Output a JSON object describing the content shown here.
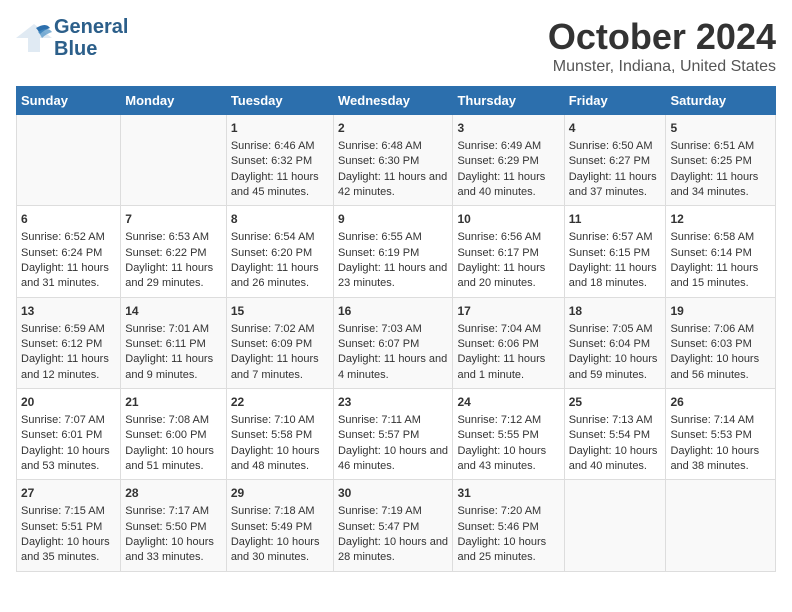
{
  "header": {
    "logo_general": "General",
    "logo_blue": "Blue",
    "title": "October 2024",
    "subtitle": "Munster, Indiana, United States"
  },
  "days_of_week": [
    "Sunday",
    "Monday",
    "Tuesday",
    "Wednesday",
    "Thursday",
    "Friday",
    "Saturday"
  ],
  "weeks": [
    [
      {
        "day": "",
        "content": ""
      },
      {
        "day": "",
        "content": ""
      },
      {
        "day": "1",
        "content": "Sunrise: 6:46 AM\nSunset: 6:32 PM\nDaylight: 11 hours and 45 minutes."
      },
      {
        "day": "2",
        "content": "Sunrise: 6:48 AM\nSunset: 6:30 PM\nDaylight: 11 hours and 42 minutes."
      },
      {
        "day": "3",
        "content": "Sunrise: 6:49 AM\nSunset: 6:29 PM\nDaylight: 11 hours and 40 minutes."
      },
      {
        "day": "4",
        "content": "Sunrise: 6:50 AM\nSunset: 6:27 PM\nDaylight: 11 hours and 37 minutes."
      },
      {
        "day": "5",
        "content": "Sunrise: 6:51 AM\nSunset: 6:25 PM\nDaylight: 11 hours and 34 minutes."
      }
    ],
    [
      {
        "day": "6",
        "content": "Sunrise: 6:52 AM\nSunset: 6:24 PM\nDaylight: 11 hours and 31 minutes."
      },
      {
        "day": "7",
        "content": "Sunrise: 6:53 AM\nSunset: 6:22 PM\nDaylight: 11 hours and 29 minutes."
      },
      {
        "day": "8",
        "content": "Sunrise: 6:54 AM\nSunset: 6:20 PM\nDaylight: 11 hours and 26 minutes."
      },
      {
        "day": "9",
        "content": "Sunrise: 6:55 AM\nSunset: 6:19 PM\nDaylight: 11 hours and 23 minutes."
      },
      {
        "day": "10",
        "content": "Sunrise: 6:56 AM\nSunset: 6:17 PM\nDaylight: 11 hours and 20 minutes."
      },
      {
        "day": "11",
        "content": "Sunrise: 6:57 AM\nSunset: 6:15 PM\nDaylight: 11 hours and 18 minutes."
      },
      {
        "day": "12",
        "content": "Sunrise: 6:58 AM\nSunset: 6:14 PM\nDaylight: 11 hours and 15 minutes."
      }
    ],
    [
      {
        "day": "13",
        "content": "Sunrise: 6:59 AM\nSunset: 6:12 PM\nDaylight: 11 hours and 12 minutes."
      },
      {
        "day": "14",
        "content": "Sunrise: 7:01 AM\nSunset: 6:11 PM\nDaylight: 11 hours and 9 minutes."
      },
      {
        "day": "15",
        "content": "Sunrise: 7:02 AM\nSunset: 6:09 PM\nDaylight: 11 hours and 7 minutes."
      },
      {
        "day": "16",
        "content": "Sunrise: 7:03 AM\nSunset: 6:07 PM\nDaylight: 11 hours and 4 minutes."
      },
      {
        "day": "17",
        "content": "Sunrise: 7:04 AM\nSunset: 6:06 PM\nDaylight: 11 hours and 1 minute."
      },
      {
        "day": "18",
        "content": "Sunrise: 7:05 AM\nSunset: 6:04 PM\nDaylight: 10 hours and 59 minutes."
      },
      {
        "day": "19",
        "content": "Sunrise: 7:06 AM\nSunset: 6:03 PM\nDaylight: 10 hours and 56 minutes."
      }
    ],
    [
      {
        "day": "20",
        "content": "Sunrise: 7:07 AM\nSunset: 6:01 PM\nDaylight: 10 hours and 53 minutes."
      },
      {
        "day": "21",
        "content": "Sunrise: 7:08 AM\nSunset: 6:00 PM\nDaylight: 10 hours and 51 minutes."
      },
      {
        "day": "22",
        "content": "Sunrise: 7:10 AM\nSunset: 5:58 PM\nDaylight: 10 hours and 48 minutes."
      },
      {
        "day": "23",
        "content": "Sunrise: 7:11 AM\nSunset: 5:57 PM\nDaylight: 10 hours and 46 minutes."
      },
      {
        "day": "24",
        "content": "Sunrise: 7:12 AM\nSunset: 5:55 PM\nDaylight: 10 hours and 43 minutes."
      },
      {
        "day": "25",
        "content": "Sunrise: 7:13 AM\nSunset: 5:54 PM\nDaylight: 10 hours and 40 minutes."
      },
      {
        "day": "26",
        "content": "Sunrise: 7:14 AM\nSunset: 5:53 PM\nDaylight: 10 hours and 38 minutes."
      }
    ],
    [
      {
        "day": "27",
        "content": "Sunrise: 7:15 AM\nSunset: 5:51 PM\nDaylight: 10 hours and 35 minutes."
      },
      {
        "day": "28",
        "content": "Sunrise: 7:17 AM\nSunset: 5:50 PM\nDaylight: 10 hours and 33 minutes."
      },
      {
        "day": "29",
        "content": "Sunrise: 7:18 AM\nSunset: 5:49 PM\nDaylight: 10 hours and 30 minutes."
      },
      {
        "day": "30",
        "content": "Sunrise: 7:19 AM\nSunset: 5:47 PM\nDaylight: 10 hours and 28 minutes."
      },
      {
        "day": "31",
        "content": "Sunrise: 7:20 AM\nSunset: 5:46 PM\nDaylight: 10 hours and 25 minutes."
      },
      {
        "day": "",
        "content": ""
      },
      {
        "day": "",
        "content": ""
      }
    ]
  ]
}
